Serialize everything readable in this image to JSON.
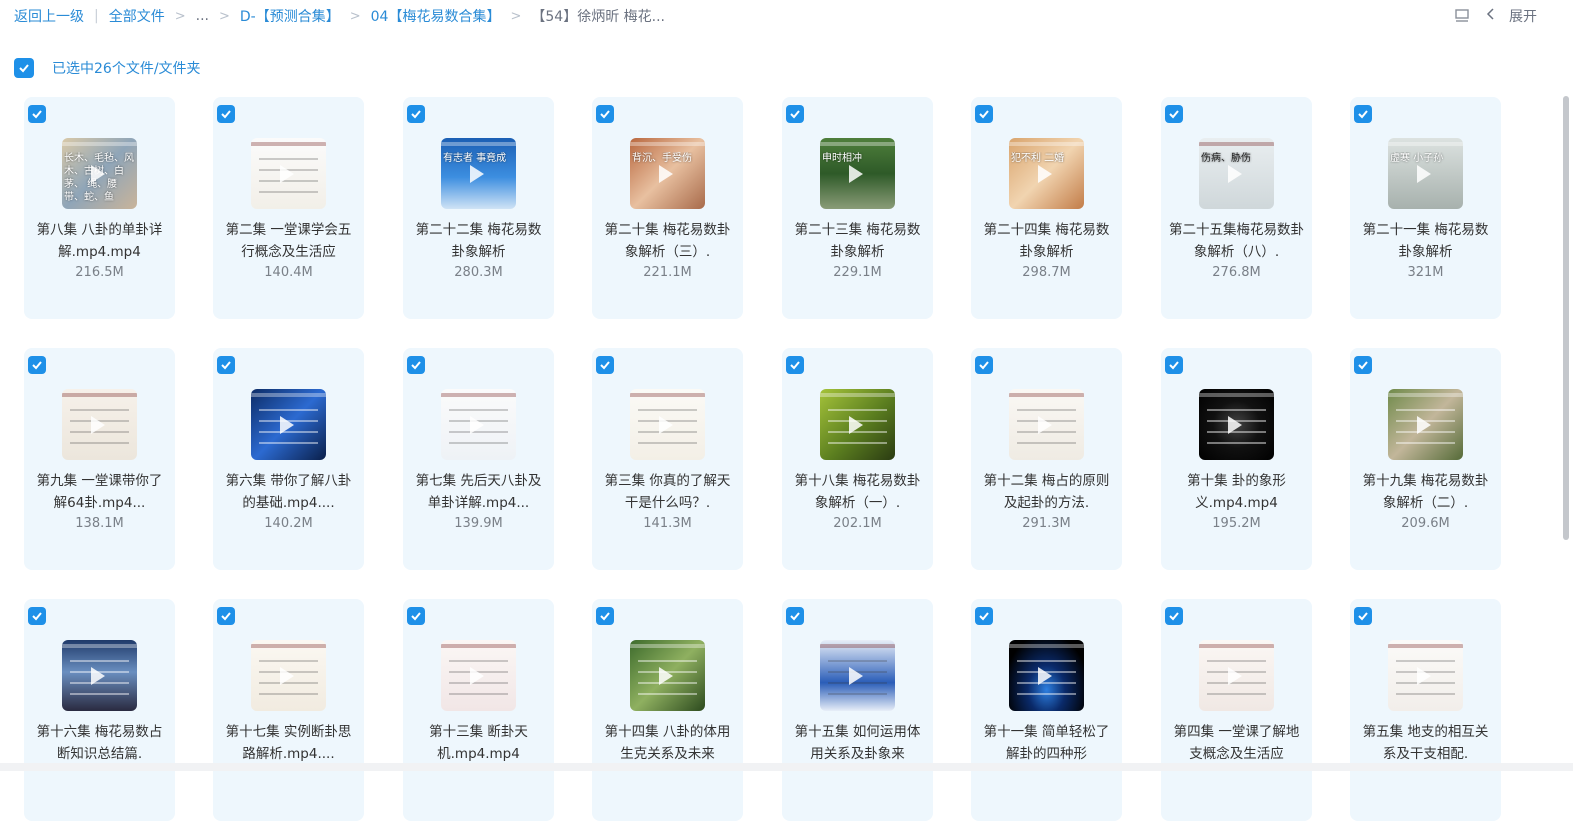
{
  "breadcrumb": {
    "back": "返回上一级",
    "all_files": "全部文件",
    "ellipsis": "...",
    "level1": "D-【预测合集】",
    "level2": "04【梅花易数合集】",
    "current": "【54】徐炳昕 梅花..."
  },
  "toolbar": {
    "expand_label": "展开"
  },
  "selection": {
    "text": "已选中26个文件/文件夹"
  },
  "colors": {
    "accent": "#1e90e8",
    "card_bg": "#eef7fd",
    "link": "#2a8bd6"
  },
  "files": [
    {
      "name": "第八集 八卦的单卦详解.mp4.mp4",
      "size": "216.5M",
      "thumb": "collage-light",
      "caption": "长木、毛毡、风 木、古树、白茅、 绳、腰带、蛇、鱼"
    },
    {
      "name": "第二集 一堂课学会五行概念及生活应",
      "size": "140.4M",
      "thumb": "slide-white",
      "caption": ""
    },
    {
      "name": "第二十二集 梅花易数卦象解析",
      "size": "280.3M",
      "thumb": "blue-ocean",
      "caption": "有志者 事竟成"
    },
    {
      "name": "第二十集 梅花易数卦象解析（三）.",
      "size": "221.1M",
      "thumb": "hands",
      "caption": "背沉、手受伤"
    },
    {
      "name": "第二十三集 梅花易数卦象解析",
      "size": "229.1M",
      "thumb": "green-forest",
      "caption": "申时相冲"
    },
    {
      "name": "第二十四集 梅花易数卦象解析",
      "size": "298.7M",
      "thumb": "shells",
      "caption": "犯不利 二婚"
    },
    {
      "name": "第二十五集梅花易数卦象解析（八）.",
      "size": "276.8M",
      "thumb": "white-text",
      "caption": "伤病、胁伤"
    },
    {
      "name": "第二十一集 梅花易数卦象解析",
      "size": "321M",
      "thumb": "white-vase",
      "caption": "虚寒 小子孙"
    },
    {
      "name": "第九集 一堂课带你了解64卦.mp4...",
      "size": "138.1M",
      "thumb": "table-slide",
      "caption": ""
    },
    {
      "name": "第六集 带你了解八卦的基础.mp4....",
      "size": "140.2M",
      "thumb": "blue-dark",
      "caption": ""
    },
    {
      "name": "第七集 先后天八卦及单卦详解.mp4...",
      "size": "139.9M",
      "thumb": "diagram-white",
      "caption": ""
    },
    {
      "name": "第三集 你真的了解天干是什么吗？.",
      "size": "141.3M",
      "thumb": "slide-white2",
      "caption": ""
    },
    {
      "name": "第十八集 梅花易数卦象解析（一）.",
      "size": "202.1M",
      "thumb": "leaf-green",
      "caption": ""
    },
    {
      "name": "第十二集 梅占的原则及起卦的方法.",
      "size": "291.3M",
      "thumb": "text-slide",
      "caption": ""
    },
    {
      "name": "第十集 卦的象形义.mp4.mp4",
      "size": "195.2M",
      "thumb": "black-yinyang",
      "caption": ""
    },
    {
      "name": "第十九集 梅花易数卦象解析（二）.",
      "size": "209.6M",
      "thumb": "old-man",
      "caption": ""
    },
    {
      "name": "第十六集 梅花易数占断知识总结篇.",
      "size": "",
      "thumb": "city-night",
      "caption": ""
    },
    {
      "name": "第十七集 实例断卦思路解析.mp4....",
      "size": "",
      "thumb": "list-slide",
      "caption": ""
    },
    {
      "name": "第十三集 断卦天机.mp4.mp4",
      "size": "",
      "thumb": "plum-slide",
      "caption": ""
    },
    {
      "name": "第十四集 八卦的体用生克关系及未来",
      "size": "",
      "thumb": "tree-green",
      "caption": ""
    },
    {
      "name": "第十五集 如何运用体用关系及卦象来",
      "size": "",
      "thumb": "blue-slide",
      "caption": ""
    },
    {
      "name": "第十一集 简单轻松了解卦的四种形",
      "size": "",
      "thumb": "dark-blue-swirl",
      "caption": ""
    },
    {
      "name": "第四集 一堂课了解地支概念及生活应",
      "size": "",
      "thumb": "plum-slide2",
      "caption": ""
    },
    {
      "name": "第五集 地支的相互关系及干支相配.",
      "size": "",
      "thumb": "figure-slide",
      "caption": ""
    }
  ]
}
